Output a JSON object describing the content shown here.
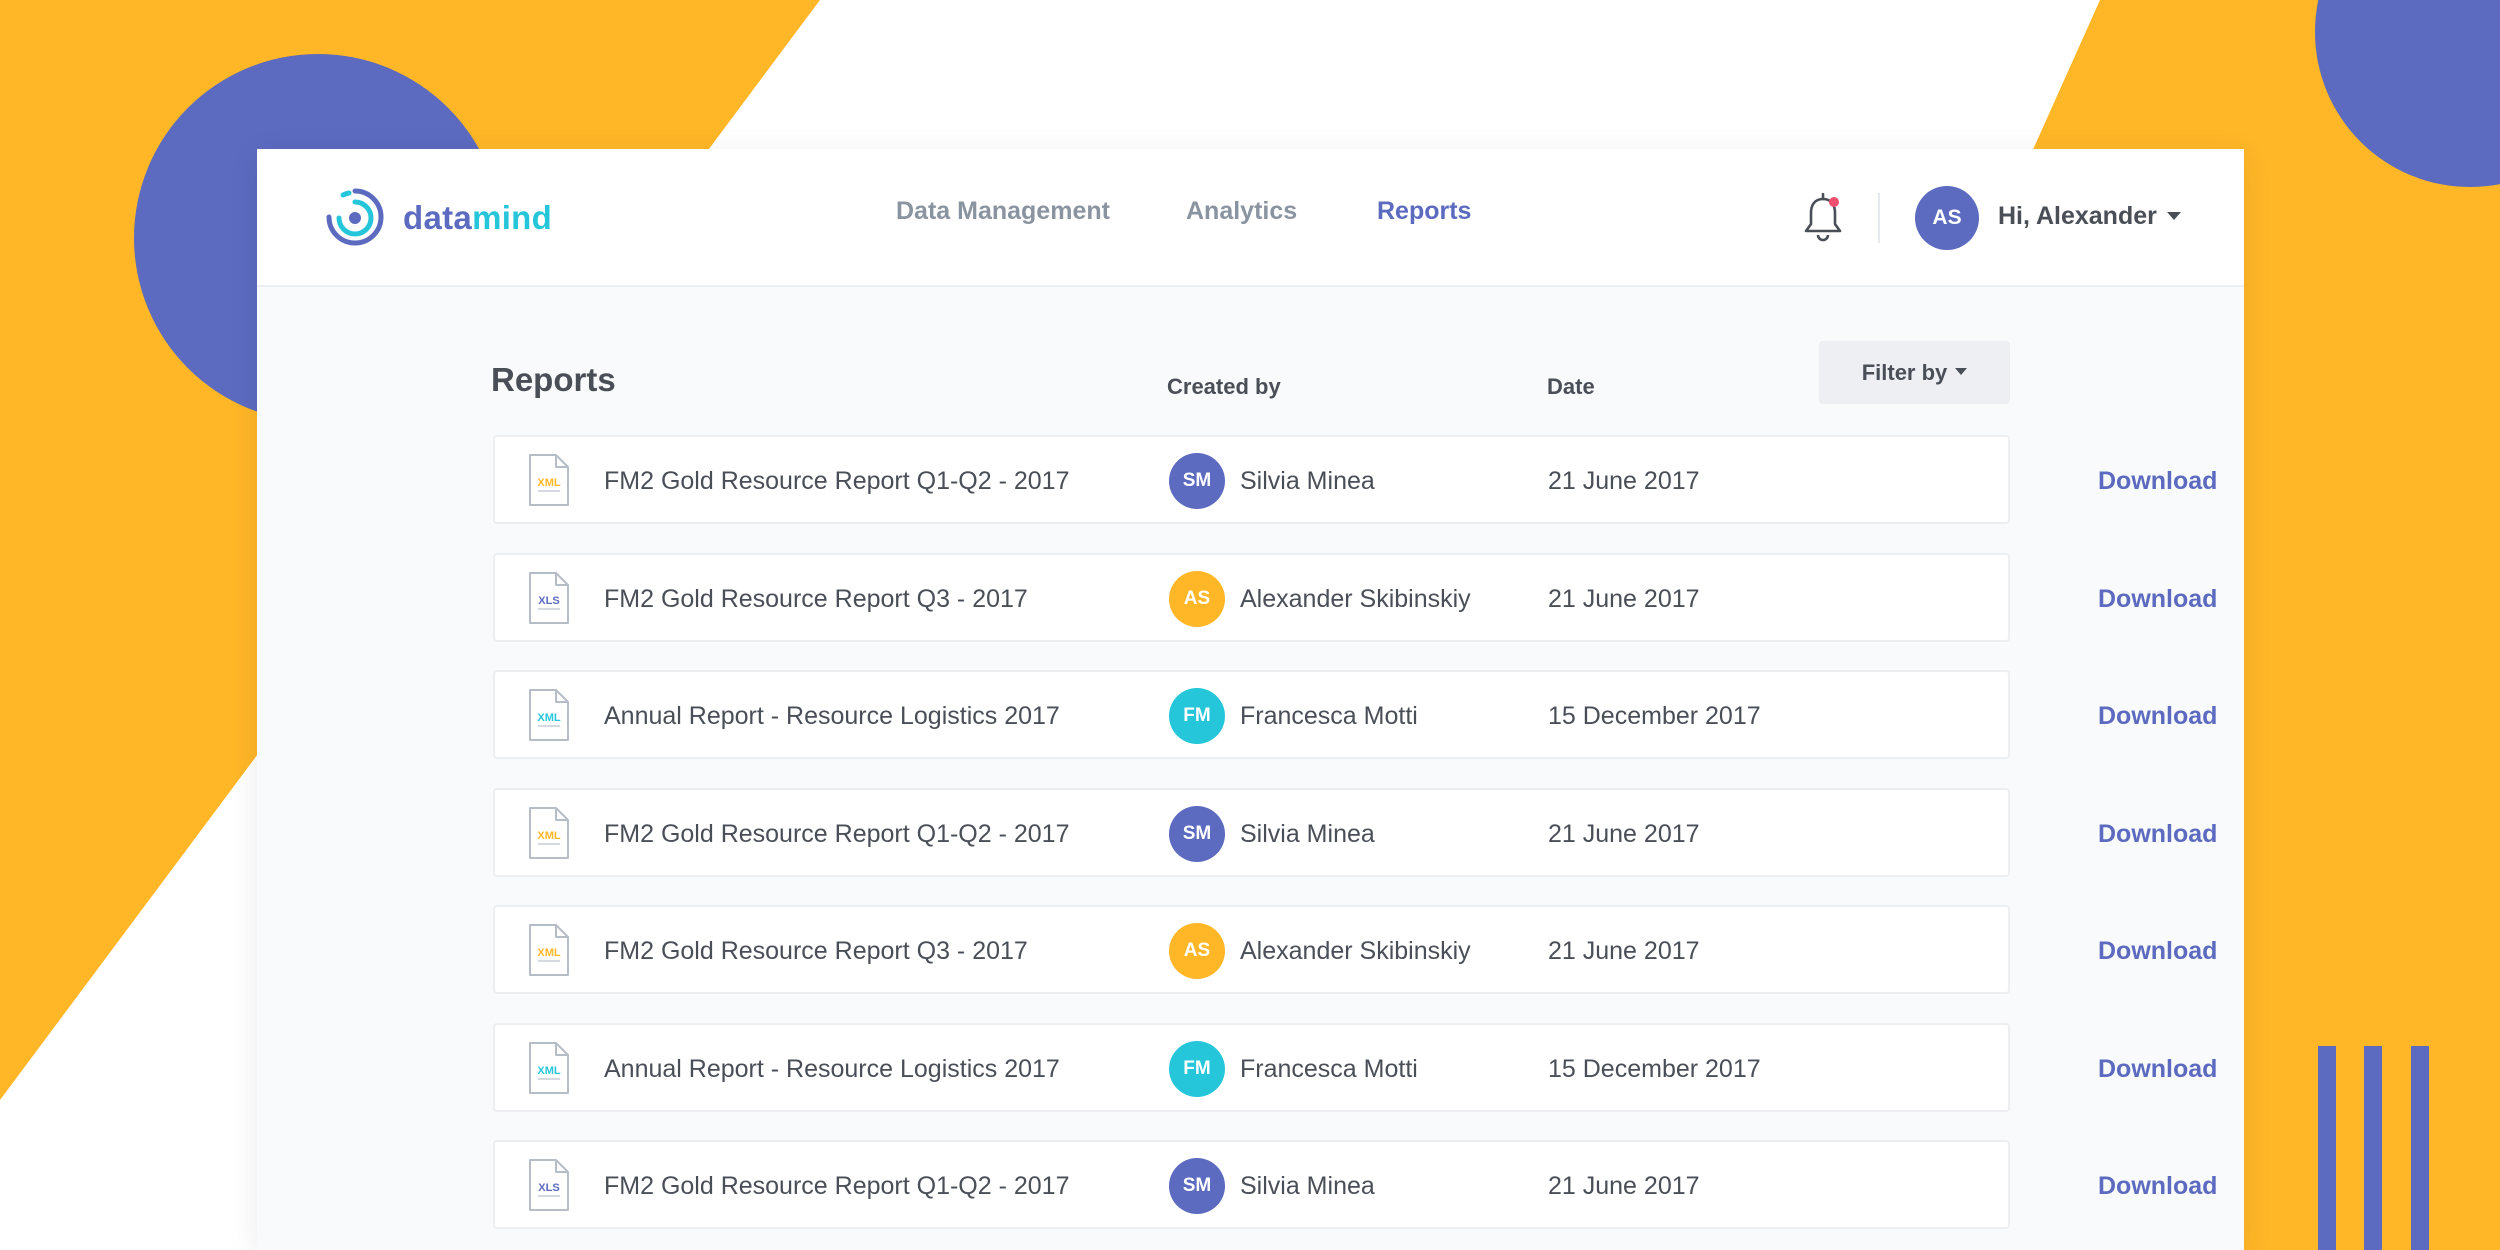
{
  "colors": {
    "background": "#FFB627",
    "accent": "#5C6BC0",
    "teal": "#26C6DA",
    "amber": "#FFB627"
  },
  "brand": {
    "name_part1": "data",
    "name_part2": "mind"
  },
  "nav": {
    "items": [
      {
        "label": "Data Management",
        "active": false
      },
      {
        "label": "Analytics",
        "active": false
      },
      {
        "label": "Reports",
        "active": true
      }
    ]
  },
  "header": {
    "notification_icon": "bell-icon",
    "user_initials": "AS",
    "greeting": "Hi, Alexander"
  },
  "reports": {
    "title": "Reports",
    "columns": {
      "created_by": "Created by",
      "date": "Date"
    },
    "filter_label": "Filter by",
    "rows": [
      {
        "file_type": "XML",
        "file_color": "#FFB627",
        "title": "FM2 Gold Resource Report Q1-Q2 - 2017",
        "author_initials": "SM",
        "author_color": "#5C6BC0",
        "author": "Silvia Minea",
        "date": "21 June 2017",
        "action": "Download"
      },
      {
        "file_type": "XLS",
        "file_color": "#5C6BC0",
        "title": "FM2 Gold Resource Report Q3 - 2017",
        "author_initials": "AS",
        "author_color": "#FFB627",
        "author": "Alexander Skibinskiy",
        "date": "21 June 2017",
        "action": "Download"
      },
      {
        "file_type": "XML",
        "file_color": "#26C6DA",
        "title": "Annual Report - Resource Logistics 2017",
        "author_initials": "FM",
        "author_color": "#26C6DA",
        "author": "Francesca Motti",
        "date": "15 December 2017",
        "action": "Download"
      },
      {
        "file_type": "XML",
        "file_color": "#FFB627",
        "title": "FM2 Gold Resource Report Q1-Q2 - 2017",
        "author_initials": "SM",
        "author_color": "#5C6BC0",
        "author": "Silvia Minea",
        "date": "21 June 2017",
        "action": "Download"
      },
      {
        "file_type": "XML",
        "file_color": "#FFB627",
        "title": "FM2 Gold Resource Report Q3 - 2017",
        "author_initials": "AS",
        "author_color": "#FFB627",
        "author": "Alexander Skibinskiy",
        "date": "21 June 2017",
        "action": "Download"
      },
      {
        "file_type": "XML",
        "file_color": "#26C6DA",
        "title": "Annual Report - Resource Logistics 2017",
        "author_initials": "FM",
        "author_color": "#26C6DA",
        "author": "Francesca Motti",
        "date": "15 December 2017",
        "action": "Download"
      },
      {
        "file_type": "XLS",
        "file_color": "#5C6BC0",
        "title": "FM2 Gold Resource Report Q1-Q2 - 2017",
        "author_initials": "SM",
        "author_color": "#5C6BC0",
        "author": "Silvia Minea",
        "date": "21 June 2017",
        "action": "Download"
      }
    ]
  }
}
